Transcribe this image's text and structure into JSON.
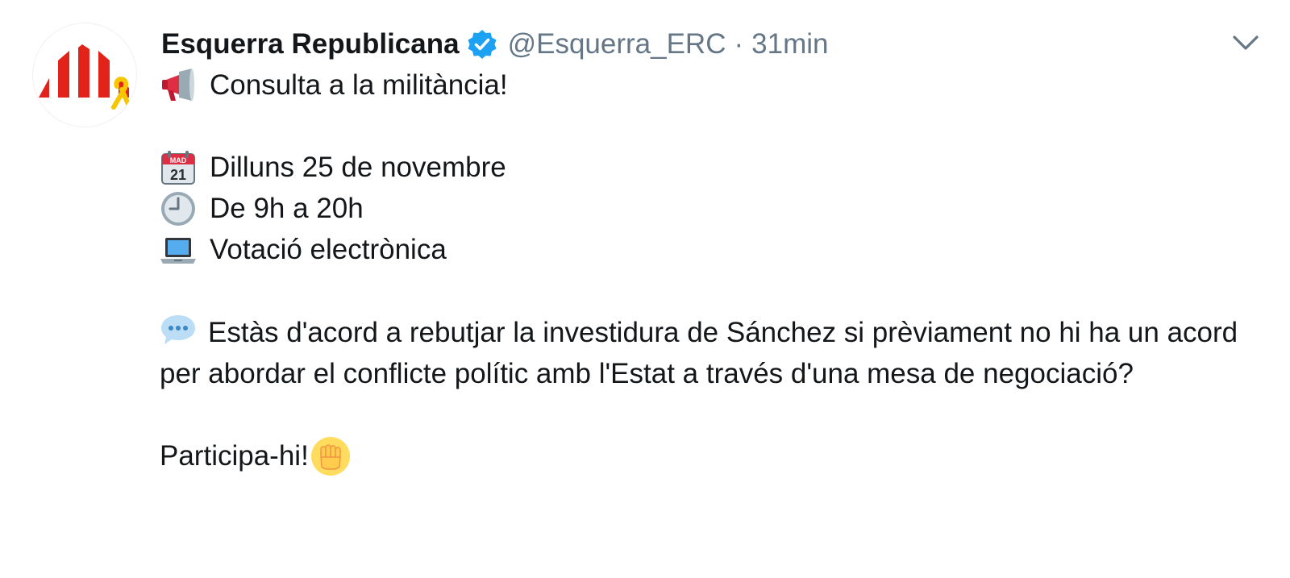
{
  "tweet": {
    "author": {
      "display_name": "Esquerra Republicana",
      "handle": "@Esquerra_ERC",
      "verified": true,
      "avatar_icon": "erc-logo-icon"
    },
    "separator": "·",
    "timestamp": "31min",
    "menu_icon": "chevron-down-icon",
    "lines": {
      "headline": "Consulta a la militància!",
      "date": "Dilluns 25 de novembre",
      "hours": "De 9h a 20h",
      "voting": "Votació electrònica",
      "question": "Estàs d'acord a rebutjar la investidura de Sánchez si prèviament no hi ha un acord per abordar el conflicte polític amb l'Estat a través d'una mesa de negociació?",
      "call_to_action": "Participa-hi!"
    },
    "emoji_icons": {
      "headline": "megaphone-icon",
      "date": "calendar-icon",
      "hours": "clock-icon",
      "voting": "laptop-icon",
      "question": "speech-bubble-icon",
      "call_to_action": "raised-fist-icon"
    },
    "calendar_icon_text": {
      "month": "MAD",
      "day": "21"
    },
    "colors": {
      "name": "#14171a",
      "secondary": "#657786",
      "verified": "#1da1f2",
      "erc_red": "#e2231a",
      "erc_yellow": "#f6c600"
    }
  }
}
